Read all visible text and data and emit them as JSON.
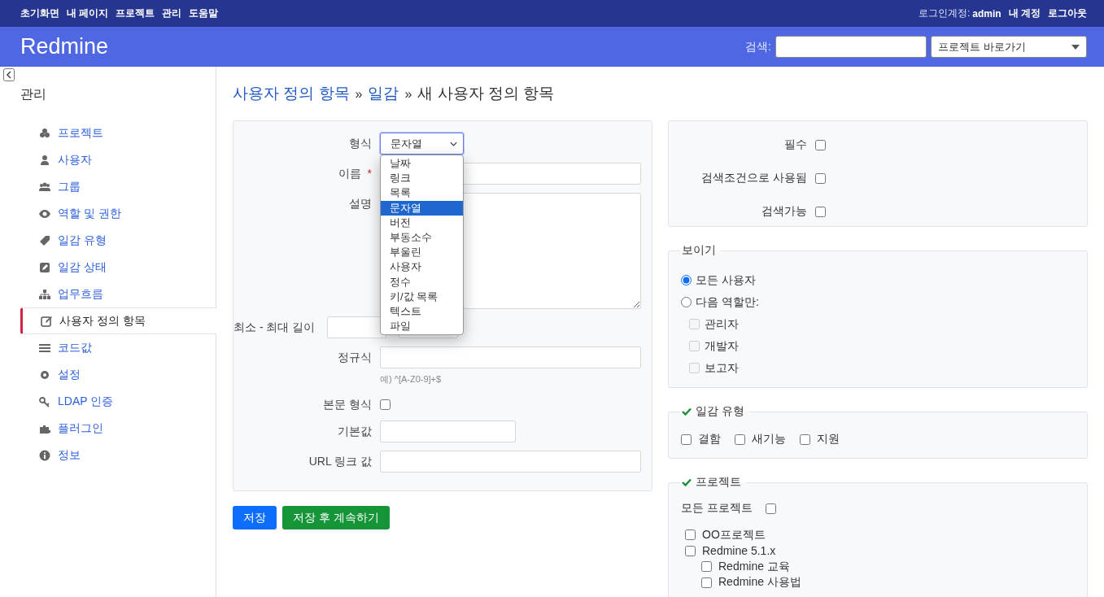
{
  "top_menu": [
    {
      "label": "초기화면"
    },
    {
      "label": "내 페이지"
    },
    {
      "label": "프로젝트"
    },
    {
      "label": "관리"
    },
    {
      "label": "도움말"
    }
  ],
  "account": {
    "prefix": "로그인계정:",
    "user": "admin",
    "links": [
      "내 계정",
      "로그아웃"
    ]
  },
  "header": {
    "title": "Redmine",
    "search_label": "검색:",
    "jump_value": "프로젝트 바로가기"
  },
  "sidebar": {
    "title": "관리",
    "items": [
      {
        "label": "프로젝트",
        "kind": "project",
        "selected": false
      },
      {
        "label": "사용자",
        "kind": "user",
        "selected": false
      },
      {
        "label": "그룹",
        "kind": "group",
        "selected": false
      },
      {
        "label": "역할 및 권한",
        "kind": "role",
        "selected": false
      },
      {
        "label": "일감 유형",
        "kind": "tracker",
        "selected": false
      },
      {
        "label": "일감 상태",
        "kind": "status",
        "selected": false
      },
      {
        "label": "업무흐름",
        "kind": "workflow",
        "selected": false
      },
      {
        "label": "사용자 정의 항목",
        "kind": "custom_field",
        "selected": true
      },
      {
        "label": "코드값",
        "kind": "enumeration",
        "selected": false
      },
      {
        "label": "설정",
        "kind": "settings",
        "selected": false
      },
      {
        "label": "LDAP 인증",
        "kind": "ldap",
        "selected": false
      },
      {
        "label": "플러그인",
        "kind": "plugin",
        "selected": false
      },
      {
        "label": "정보",
        "kind": "info",
        "selected": false
      }
    ]
  },
  "breadcrumb": {
    "separator": "»",
    "items": [
      {
        "label": "사용자 정의 항목",
        "link": true
      },
      {
        "label": "일감",
        "link": true
      },
      {
        "label": "새 사용자 정의 항목",
        "link": false
      }
    ]
  },
  "form": {
    "fields": [
      {
        "kind": "select",
        "label": "형식",
        "value": "문자열",
        "expanded": true,
        "options": [
          {
            "label": "날짜",
            "selected": false
          },
          {
            "label": "링크",
            "selected": false
          },
          {
            "label": "목록",
            "selected": false
          },
          {
            "label": "문자열",
            "selected": true
          },
          {
            "label": "버전",
            "selected": false
          },
          {
            "label": "부동소수",
            "selected": false
          },
          {
            "label": "부울린",
            "selected": false
          },
          {
            "label": "사용자",
            "selected": false
          },
          {
            "label": "정수",
            "selected": false
          },
          {
            "label": "키/값 목록",
            "selected": false
          },
          {
            "label": "텍스트",
            "selected": false
          },
          {
            "label": "파일",
            "selected": false
          }
        ]
      },
      {
        "kind": "text",
        "label": "이름",
        "required_mark": "*"
      },
      {
        "kind": "textarea",
        "label": "설명"
      },
      {
        "kind": "range",
        "label": "최소 - 최대 길이"
      },
      {
        "kind": "text",
        "label": "정규식",
        "hint": "예) ^[A-Z0-9]+$"
      },
      {
        "kind": "checkbox",
        "label": "본문 형식",
        "checked": false
      },
      {
        "kind": "short",
        "label": "기본값"
      },
      {
        "kind": "text",
        "label": "URL 링크 값"
      }
    ]
  },
  "buttons": [
    {
      "label": "저장",
      "kind": "primary"
    },
    {
      "label": "저장 후 계속하기",
      "kind": "success"
    }
  ],
  "flags": [
    {
      "label": "필수",
      "checked": false
    },
    {
      "label": "검색조건으로 사용됨",
      "checked": false
    },
    {
      "label": "검색가능",
      "checked": false
    }
  ],
  "visibility": {
    "legend": "보이기",
    "options": [
      {
        "label": "모든 사용자",
        "selected": true
      },
      {
        "label": "다음 역할만:",
        "selected": false
      }
    ],
    "roles": [
      {
        "label": "관리자",
        "checked": false,
        "disabled": true
      },
      {
        "label": "개발자",
        "checked": false,
        "disabled": true
      },
      {
        "label": "보고자",
        "checked": false,
        "disabled": true
      }
    ]
  },
  "trackers": {
    "legend": "일감 유형",
    "items": [
      {
        "label": "결함",
        "checked": false
      },
      {
        "label": "새기능",
        "checked": false
      },
      {
        "label": "지원",
        "checked": false
      }
    ]
  },
  "projects": {
    "legend": "프로젝트",
    "all_label": "모든 프로젝트",
    "all_checked": false,
    "tree": [
      {
        "label": "OO프로젝트",
        "checked": false
      },
      {
        "label": "Redmine 5.1.x",
        "checked": false,
        "children": [
          {
            "label": "Redmine 교육",
            "checked": false
          },
          {
            "label": "Redmine 사용법",
            "checked": false
          }
        ]
      }
    ]
  }
}
